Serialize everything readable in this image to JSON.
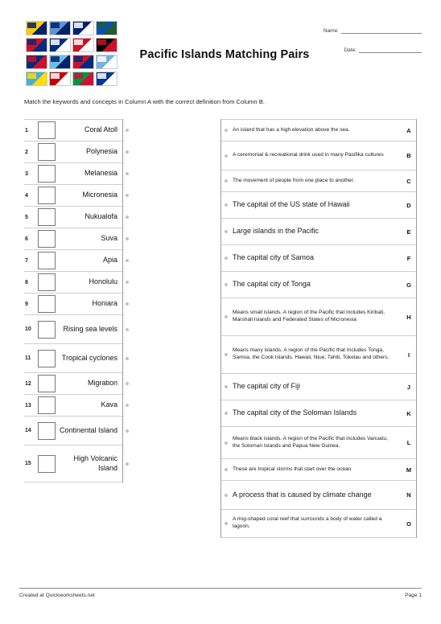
{
  "document": {
    "title": "Pacific Islands Matching Pairs",
    "instructions": "Match the keywords and concepts in Column A with the correct definition from Column B."
  },
  "meta": {
    "name_label": "Name:",
    "date_label": "Date:",
    "name_value": "",
    "date_value": ""
  },
  "flags": [
    {
      "name": "flag-niue",
      "colors": [
        "#FFCC00",
        "#012169"
      ]
    },
    {
      "name": "flag-tuvalu",
      "colors": [
        "#5B97D1",
        "#012169"
      ]
    },
    {
      "name": "flag-cook-islands",
      "colors": [
        "#012169",
        "#FFFFFF"
      ]
    },
    {
      "name": "flag-solomon-islands",
      "colors": [
        "#0051BA",
        "#215B33"
      ]
    },
    {
      "name": "flag-samoa",
      "colors": [
        "#CE1126",
        "#002B7F"
      ]
    },
    {
      "name": "flag-tokelau",
      "colors": [
        "#002B7F",
        "#FFFFFF"
      ]
    },
    {
      "name": "flag-tahiti",
      "colors": [
        "#CE1126",
        "#FFFFFF"
      ]
    },
    {
      "name": "flag-papua-new-guinea",
      "colors": [
        "#000000",
        "#CE1126"
      ]
    },
    {
      "name": "flag-american-samoa",
      "colors": [
        "#002B7F",
        "#CE1126"
      ]
    },
    {
      "name": "flag-fiji",
      "colors": [
        "#68BFE5",
        "#012169"
      ]
    },
    {
      "name": "flag-kiribati",
      "colors": [
        "#CE1126",
        "#002B7F"
      ]
    },
    {
      "name": "flag-federated-states-of-micronesia",
      "colors": [
        "#75B2DD",
        "#FFFFFF"
      ]
    },
    {
      "name": "flag-palau",
      "colors": [
        "#4AADD6",
        "#FFDE00"
      ]
    },
    {
      "name": "flag-tonga",
      "colors": [
        "#C10000",
        "#FFFFFF"
      ]
    },
    {
      "name": "flag-vanuatu",
      "colors": [
        "#009543",
        "#D21034"
      ]
    },
    {
      "name": "flag-marshall-islands",
      "colors": [
        "#003893",
        "#FFFFFF"
      ]
    }
  ],
  "column_a": {
    "items": [
      {
        "number": "1",
        "label": "Coral Atoll",
        "lines": 1
      },
      {
        "number": "2",
        "label": "Polynesia",
        "lines": 1
      },
      {
        "number": "3",
        "label": "Melanesia",
        "lines": 1
      },
      {
        "number": "4",
        "label": "Micronesia",
        "lines": 1
      },
      {
        "number": "5",
        "label": "Nukualofa",
        "lines": 1
      },
      {
        "number": "6",
        "label": "Suva",
        "lines": 1
      },
      {
        "number": "7",
        "label": "Apia",
        "lines": 1
      },
      {
        "number": "8",
        "label": "Honolulu",
        "lines": 1
      },
      {
        "number": "9",
        "label": "Honiara",
        "lines": 1
      },
      {
        "number": "10",
        "label": "Rising sea levels",
        "lines": 2
      },
      {
        "number": "11",
        "label": "Tropical cyclones",
        "lines": 2
      },
      {
        "number": "12",
        "label": "Migration",
        "lines": 1
      },
      {
        "number": "13",
        "label": "Kava",
        "lines": 1
      },
      {
        "number": "14",
        "label": "Continental Island",
        "lines": 2
      },
      {
        "number": "15",
        "label": "High Volcanic Island",
        "lines": 3
      }
    ]
  },
  "column_b": {
    "items": [
      {
        "letter": "A",
        "text": "An island that has a high elevation above the sea.",
        "size": "small"
      },
      {
        "letter": "B",
        "text": "A ceremonial & recreational drink used in many Pasifika cultures",
        "size": "small"
      },
      {
        "letter": "C",
        "text": "The movement of people from one place to another.",
        "size": "small"
      },
      {
        "letter": "D",
        "text": "The capital of the US state of Hawaii",
        "size": "big"
      },
      {
        "letter": "E",
        "text": "Large islands in the Pacific",
        "size": "big"
      },
      {
        "letter": "F",
        "text": "The capital city of Samoa",
        "size": "big"
      },
      {
        "letter": "G",
        "text": "The capital city of Tonga",
        "size": "big"
      },
      {
        "letter": "H",
        "text": "Means small islands. A region of the Pacific that includes Kiribati, Marshall Islands and Federated States of Micronesia",
        "size": "small"
      },
      {
        "letter": "I",
        "text": "Means many islands. A region of the Pacific that Includes Tonga, Samoa, the Cook Islands, Hawaii, Niue, Tahiti, Tokelau and others.",
        "size": "small"
      },
      {
        "letter": "J",
        "text": "The capital city of Fiji",
        "size": "big"
      },
      {
        "letter": "K",
        "text": "The capital city of the Soloman Islands",
        "size": "big"
      },
      {
        "letter": "L",
        "text": "Means black islands. A region of the Pacific that includes Vanuatu, the Soloman Islands and Papua New Guinea.",
        "size": "small"
      },
      {
        "letter": "M",
        "text": "These are tropical storms that start over the ocean",
        "size": "small"
      },
      {
        "letter": "N",
        "text": "A process that is caused by climate change",
        "size": "big"
      },
      {
        "letter": "O",
        "text": "A ring-shaped coral reef that surrounds a body of water called a lagoon.",
        "size": "small"
      }
    ]
  },
  "footer": {
    "credit": "Created at Quickworksheets.net",
    "page": "Page 1"
  }
}
